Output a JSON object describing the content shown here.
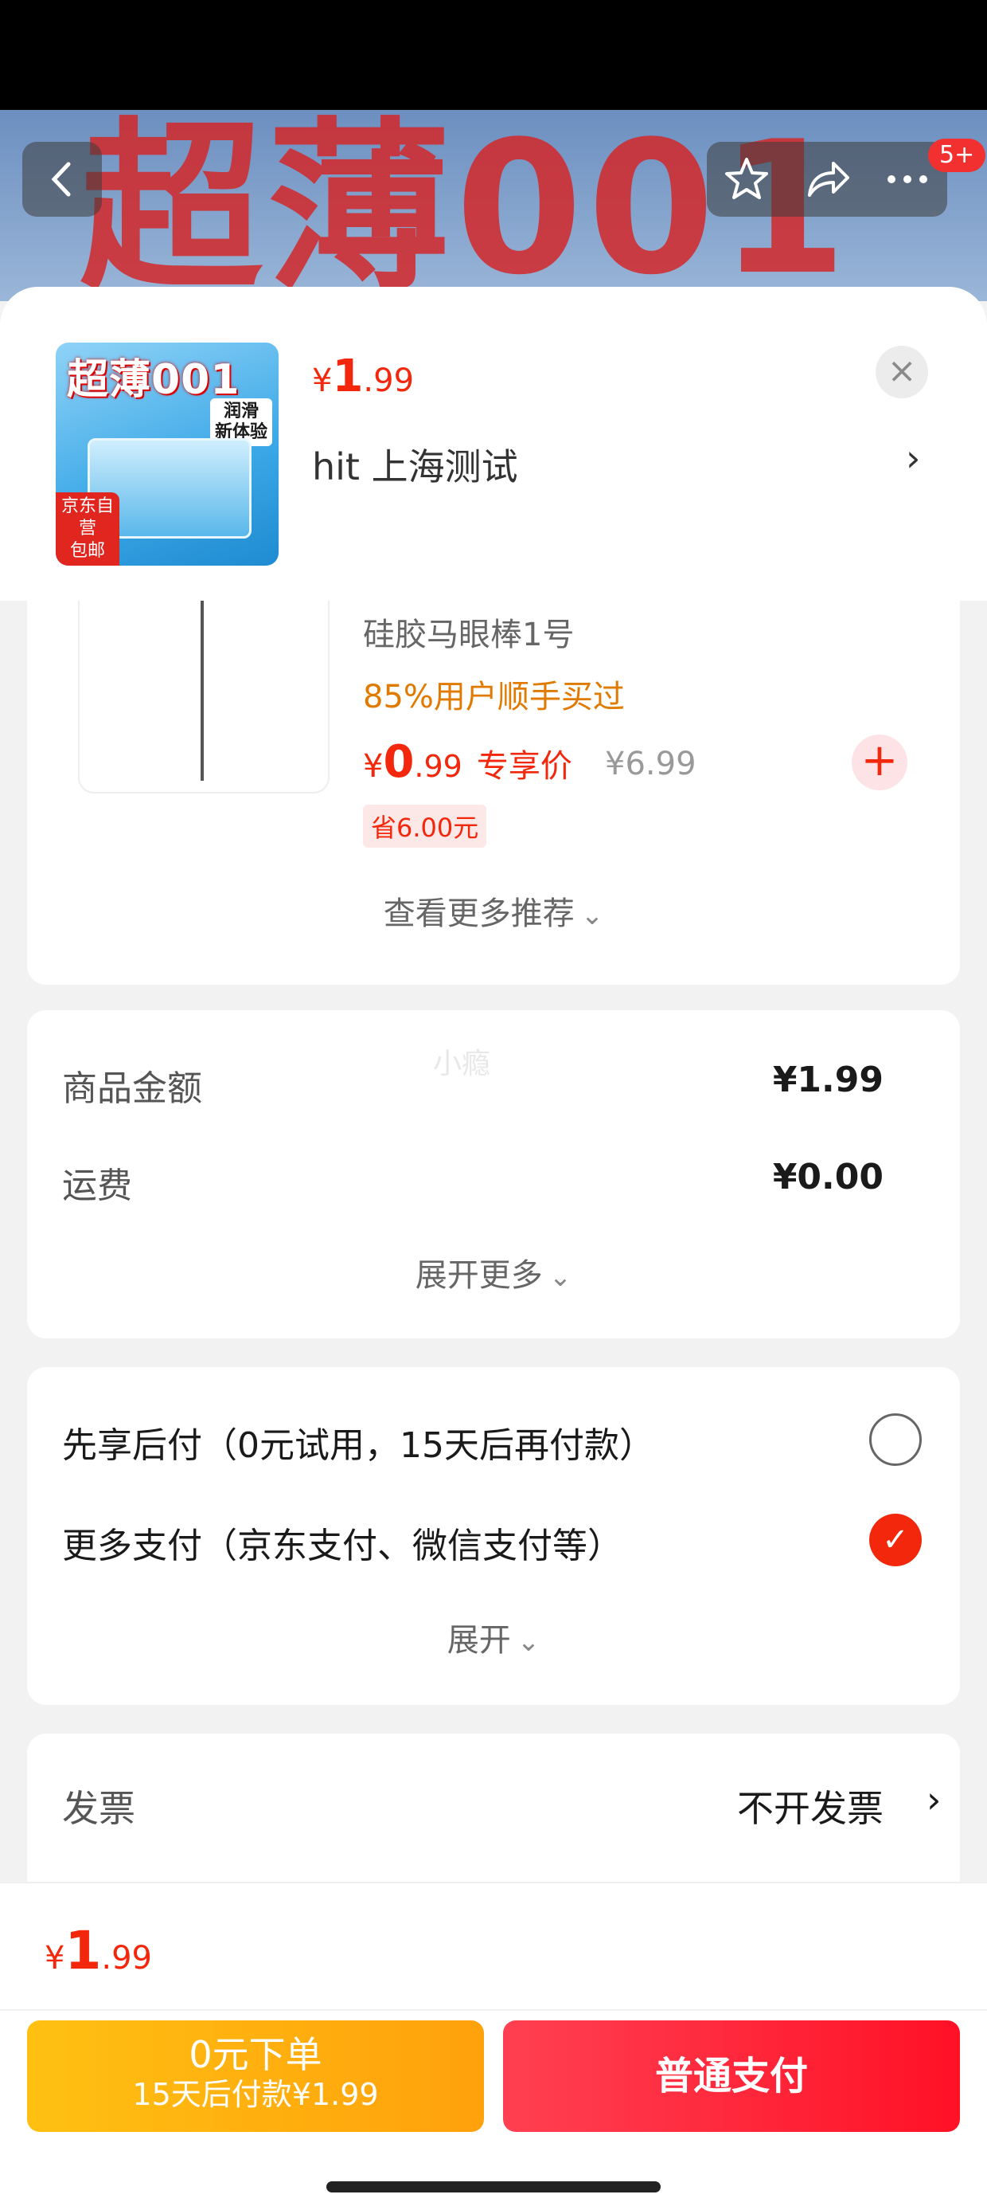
{
  "banner": {
    "title": "超薄001",
    "badge": "5+"
  },
  "icons": {
    "back": "chevron-left-icon",
    "favorite": "star-icon",
    "share": "share-icon",
    "more": "more-dots-icon",
    "close": "close-icon"
  },
  "header": {
    "thumb_title": "超薄001",
    "thumb_tag_line1": "润滑",
    "thumb_tag_line2": "新体验",
    "thumb_corner_line1": "京东自营",
    "thumb_corner_line2": "包邮",
    "price_currency": "¥",
    "price_int": "1",
    "price_dec": ".99",
    "address": "hit  上海测试",
    "close": "×"
  },
  "recommend": {
    "name": "硅胶马眼棒1号",
    "purchase_rate": "85%用户顺手买过",
    "price_currency": "¥",
    "price_int": "0",
    "price_dec": ".99",
    "price_label": "专享价",
    "original_price": "¥6.99",
    "saving": "省6.00元",
    "more": "查看更多推荐"
  },
  "amount": {
    "goods_label": "商品金额",
    "goods_value": "¥1.99",
    "shipping_label": "运费",
    "shipping_value": "¥0.00",
    "watermark": "小瘾",
    "expand": "展开更多"
  },
  "payment": {
    "option1": "先享后付（0元试用，15天后再付款）",
    "option2": "更多支付（京东支付、微信支付等）",
    "option1_selected": false,
    "option2_selected": true,
    "expand": "展开"
  },
  "invoice": {
    "label": "发票",
    "value": "不开发票"
  },
  "footer": {
    "price_currency": "¥",
    "price_int": "1",
    "price_dec": ".99",
    "later_line1": "0元下单",
    "later_line2": "15天后付款¥1.99",
    "pay_button": "普通支付"
  },
  "colors": {
    "accent": "#f2270c",
    "orange": "#ffa10c",
    "orange_text": "#e07a00"
  }
}
